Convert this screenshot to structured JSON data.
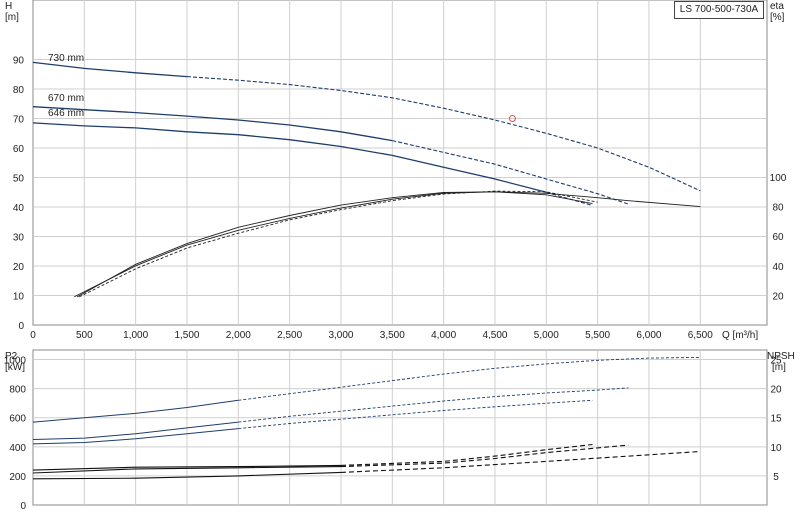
{
  "title": "LS 700-500-730A",
  "colors": {
    "duty_curve": "#1f3d6b",
    "efficiency": "#222222",
    "npsh": "#111111",
    "grid": "#cfcfcf",
    "duty_point": "#e05050"
  },
  "top_axes": {
    "left_label": [
      "H",
      "[m]"
    ],
    "right_label": [
      "eta",
      "[%]"
    ],
    "y_ticks": [
      0,
      10,
      20,
      30,
      40,
      50,
      60,
      70,
      80,
      90
    ],
    "eta_ticks": [
      20,
      40,
      60,
      80,
      100
    ],
    "x_ticks": [
      "0",
      "500",
      "1,000",
      "1,500",
      "2,000",
      "2,500",
      "3,000",
      "3,500",
      "4,000",
      "4,500",
      "5,000",
      "5,500",
      "6,000",
      "6,500"
    ],
    "x_label": "Q [m³/h]"
  },
  "bottom_axes": {
    "left_label": [
      "P2",
      "[kW]"
    ],
    "right_label": [
      "NPSH",
      "[m]"
    ],
    "y_ticks": [
      0,
      200,
      400,
      600,
      800,
      1000
    ],
    "npsh_ticks": [
      5,
      10,
      15,
      20,
      25
    ]
  },
  "chart_data": [
    {
      "type": "line",
      "panel": "head",
      "x_unit": "m³/h",
      "y_unit": "m",
      "xlim": [
        0,
        7000
      ],
      "ylim": [
        0,
        100
      ],
      "series": [
        {
          "name": "730 mm",
          "x": [
            0,
            500,
            1000,
            1500,
            2000,
            2500,
            3000,
            3500,
            4000,
            4500,
            5000,
            5500,
            6000,
            6500
          ],
          "y": [
            89,
            87,
            85.5,
            84.2,
            83,
            81.5,
            79.5,
            77,
            73.5,
            69.5,
            65,
            60,
            53.5,
            45.5
          ],
          "solid_until": 1500
        },
        {
          "name": "670 mm",
          "x": [
            0,
            500,
            1000,
            1500,
            2000,
            2500,
            3000,
            3500,
            4000,
            4500,
            5000,
            5500,
            5800
          ],
          "y": [
            74,
            73,
            72,
            70.8,
            69.5,
            67.8,
            65.5,
            62.5,
            58.5,
            54.5,
            49.5,
            44.5,
            41
          ],
          "solid_until": 3500
        },
        {
          "name": "646 mm",
          "x": [
            0,
            500,
            1000,
            1500,
            2000,
            2500,
            3000,
            3500,
            4000,
            4500,
            5000,
            5450
          ],
          "y": [
            68.5,
            67.5,
            66.8,
            65.5,
            64.5,
            62.8,
            60.5,
            57.5,
            53.5,
            49.5,
            45,
            40.5
          ],
          "solid_until": 5000
        }
      ],
      "duty_point": {
        "x": 4670,
        "y": 70
      }
    },
    {
      "type": "line",
      "panel": "efficiency",
      "x_unit": "m³/h",
      "y_unit": "%",
      "ylim": [
        0,
        100
      ],
      "series": [
        {
          "x": [
            400,
            1000,
            1500,
            2000,
            2500,
            3000,
            3500,
            4000,
            4500,
            5000,
            5500,
            5800,
            6500
          ],
          "y": [
            19,
            40,
            54,
            64,
            72,
            79,
            85,
            89,
            90,
            89,
            86,
            84,
            80
          ]
        },
        {
          "x": [
            430,
            1000,
            1500,
            2000,
            2500,
            3000,
            3500,
            4000,
            4500,
            5000,
            5450
          ],
          "y": [
            19,
            41,
            55,
            66,
            74,
            81,
            86,
            89.5,
            90,
            88,
            82
          ]
        },
        {
          "x": [
            450,
            1000,
            1500,
            2000,
            2500,
            3000,
            3500,
            4000,
            4500,
            5000,
            5500
          ],
          "y": [
            19,
            38,
            52,
            62,
            71,
            78,
            84,
            88.5,
            90.5,
            90,
            83
          ]
        }
      ]
    },
    {
      "type": "line",
      "panel": "power",
      "x_unit": "m³/h",
      "y_unit": "kW",
      "ylim": [
        0,
        1100
      ],
      "series": [
        {
          "x": [
            0,
            500,
            1000,
            1500,
            2000,
            2500,
            3000,
            3500,
            4000,
            4500,
            5000,
            5500,
            6000,
            6500
          ],
          "y": [
            570,
            600,
            630,
            670,
            720,
            765,
            810,
            855,
            900,
            940,
            970,
            995,
            1010,
            1015
          ]
        },
        {
          "x": [
            0,
            500,
            1000,
            1500,
            2000,
            2500,
            3000,
            3500,
            4000,
            4500,
            5000,
            5500,
            5800
          ],
          "y": [
            450,
            460,
            490,
            530,
            570,
            610,
            645,
            680,
            715,
            745,
            770,
            790,
            805
          ]
        },
        {
          "x": [
            0,
            500,
            1000,
            1500,
            2000,
            2500,
            3000,
            3500,
            4000,
            4500,
            5000,
            5450
          ],
          "y": [
            420,
            430,
            455,
            490,
            525,
            560,
            590,
            620,
            650,
            675,
            700,
            720
          ]
        }
      ]
    },
    {
      "type": "line",
      "panel": "npsh",
      "x_unit": "m³/h",
      "y_unit": "m",
      "ylim": [
        0,
        27.5
      ],
      "series": [
        {
          "x": [
            0,
            1000,
            2000,
            3000,
            4000,
            4500,
            5000,
            5450
          ],
          "y": [
            6,
            6.5,
            6.6,
            6.8,
            7.5,
            8.4,
            9.5,
            10.4
          ]
        },
        {
          "x": [
            0,
            1000,
            2000,
            3000,
            4000,
            4500,
            5000,
            5800
          ],
          "y": [
            5.5,
            6.2,
            6.4,
            6.6,
            7.2,
            8.0,
            9.0,
            10.3
          ]
        },
        {
          "x": [
            0,
            1000,
            2000,
            3000,
            4000,
            5000,
            6500
          ],
          "y": [
            4.5,
            4.6,
            5,
            5.6,
            6.4,
            7.5,
            9.2
          ]
        }
      ]
    }
  ],
  "curve_labels": [
    "730 mm",
    "670 mm",
    "646 mm"
  ]
}
